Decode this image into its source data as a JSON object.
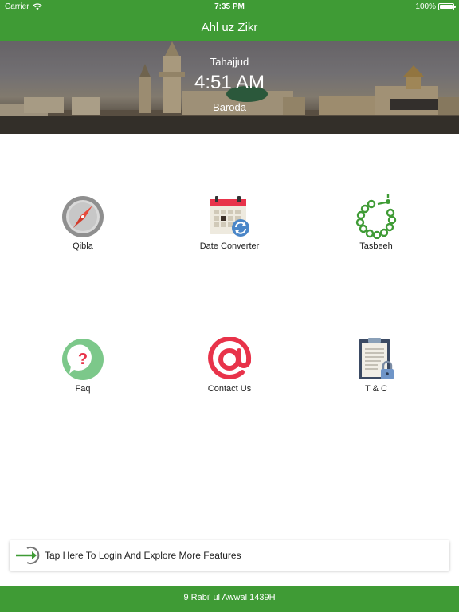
{
  "status_bar": {
    "carrier": "Carrier",
    "time": "7:35 PM",
    "battery": "100%"
  },
  "nav": {
    "title": "Ahl uz Zikr"
  },
  "hero": {
    "prayer_name": "Tahajjud",
    "prayer_time": "4:51 AM",
    "city": "Baroda"
  },
  "features": [
    {
      "label": "Qibla",
      "icon": "compass-icon"
    },
    {
      "label": "Date Converter",
      "icon": "calendar-sync-icon"
    },
    {
      "label": "Tasbeeh",
      "icon": "prayer-beads-icon"
    },
    {
      "label": "Faq",
      "icon": "question-bubble-icon"
    },
    {
      "label": "Contact Us",
      "icon": "at-sign-icon"
    },
    {
      "label": "T & C",
      "icon": "clipboard-lock-icon"
    }
  ],
  "login": {
    "text": "Tap Here To Login And Explore More Features",
    "icon": "login-arrow-icon"
  },
  "footer": {
    "hijri_date": "9 Rabi' ul Awwal 1439H"
  },
  "colors": {
    "brand_green": "#3f9b35",
    "contact_red": "#e8334a",
    "faq_green": "#7cc88a"
  }
}
